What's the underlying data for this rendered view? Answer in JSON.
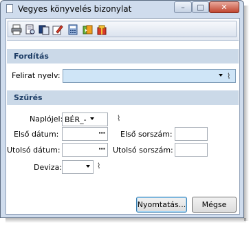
{
  "window": {
    "title": "Vegyes könyvelés bizonylat",
    "controls": {
      "minimize": "–",
      "maximize": "□",
      "close": "✕"
    }
  },
  "toolbar": {
    "buttons": [
      {
        "icon": "printer-icon"
      },
      {
        "icon": "print-preview-icon"
      },
      {
        "icon": "copy-icon"
      },
      {
        "icon": "edit-icon"
      },
      {
        "icon": "calculator-icon"
      },
      {
        "icon": "export-icon"
      },
      {
        "icon": "package-icon"
      }
    ]
  },
  "sections": {
    "translation": {
      "title": "Fordítás",
      "caption_language_label": "Felirat nyelv:",
      "caption_language_value": ""
    },
    "filter": {
      "title": "Szűrés",
      "journal_label": "Naplójel:",
      "journal_value": "BÉR_-",
      "first_date_label": "Első dátum:",
      "first_date_value": "",
      "last_date_label": "Utolsó dátum:",
      "last_date_value": "",
      "first_serial_label": "Első sorszám:",
      "first_serial_value": "",
      "last_serial_label": "Utolsó sorszám:",
      "last_serial_value": "",
      "currency_label": "Deviza:",
      "currency_value": ""
    }
  },
  "buttons": {
    "print": "Nyomtatás...",
    "cancel": "Mégse"
  },
  "glyphs": {
    "ellipsis": "···",
    "clip": "⌇"
  }
}
